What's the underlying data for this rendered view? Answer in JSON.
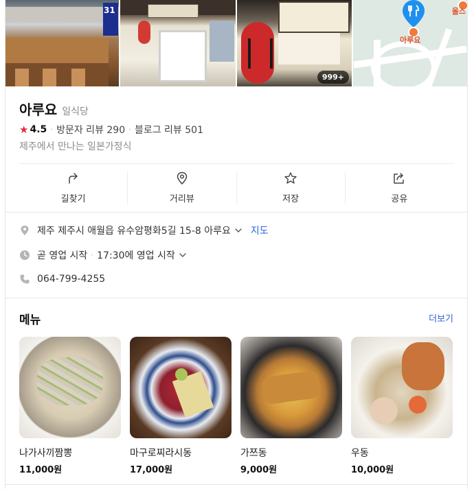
{
  "place": {
    "name": "아루요",
    "category": "일식당",
    "rating": "4.5",
    "visitor_reviews": "방문자 리뷰 290",
    "blog_reviews": "블로그 리뷰 501",
    "description": "제주에서 만나는 일본가정식"
  },
  "gallery": {
    "photo_count_badge": "999+",
    "map_label": "아루요",
    "map_label_secondary": "올스"
  },
  "actions": [
    {
      "label": "길찾기",
      "icon": "directions-icon"
    },
    {
      "label": "거리뷰",
      "icon": "location-pin-icon"
    },
    {
      "label": "저장",
      "icon": "star-icon"
    },
    {
      "label": "공유",
      "icon": "share-icon"
    }
  ],
  "info": {
    "address": "제주 제주시 애월읍 유수암평화5길 15-8 아루요",
    "map_link": "지도",
    "hours_status": "곧 영업 시작",
    "hours_detail": "17:30에 영업 시작",
    "phone": "064-799-4255"
  },
  "menu": {
    "title": "메뉴",
    "more_label": "더보기",
    "items": [
      {
        "name": "나가사끼짬뽕",
        "price": "11,000원"
      },
      {
        "name": "마구로찌라시동",
        "price": "17,000원"
      },
      {
        "name": "가쯔동",
        "price": "9,000원"
      },
      {
        "name": "우동",
        "price": "10,000원"
      }
    ]
  },
  "colors": {
    "accent_star": "#e5283d",
    "link": "#2b63d9",
    "map_pin": "#f07a3b"
  }
}
